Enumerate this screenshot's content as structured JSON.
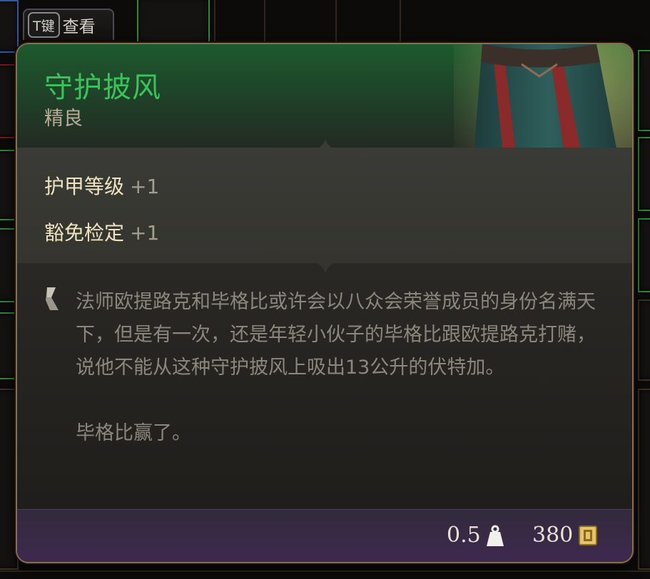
{
  "hint": {
    "key": "T键",
    "label": "查看"
  },
  "item": {
    "name": "守护披风",
    "rarity": "精良",
    "name_color": "#39c45a"
  },
  "stats": [
    {
      "name": "护甲等级",
      "value": "+1"
    },
    {
      "name": "豁免检定",
      "value": "+1"
    }
  ],
  "description": {
    "paragraph1": "法师欧提路克和毕格比或许会以八众会荣誉成员的身份名满天下，但是有一次，还是年轻小伙子的毕格比跟欧提路克打赌，说他不能从这种守护披风上吸出13公升的伏特加。",
    "paragraph2": "毕格比赢了。"
  },
  "footer": {
    "weight": "0.5",
    "weight_icon": "weight-icon",
    "value": "380",
    "value_icon": "gold-coin-icon"
  }
}
